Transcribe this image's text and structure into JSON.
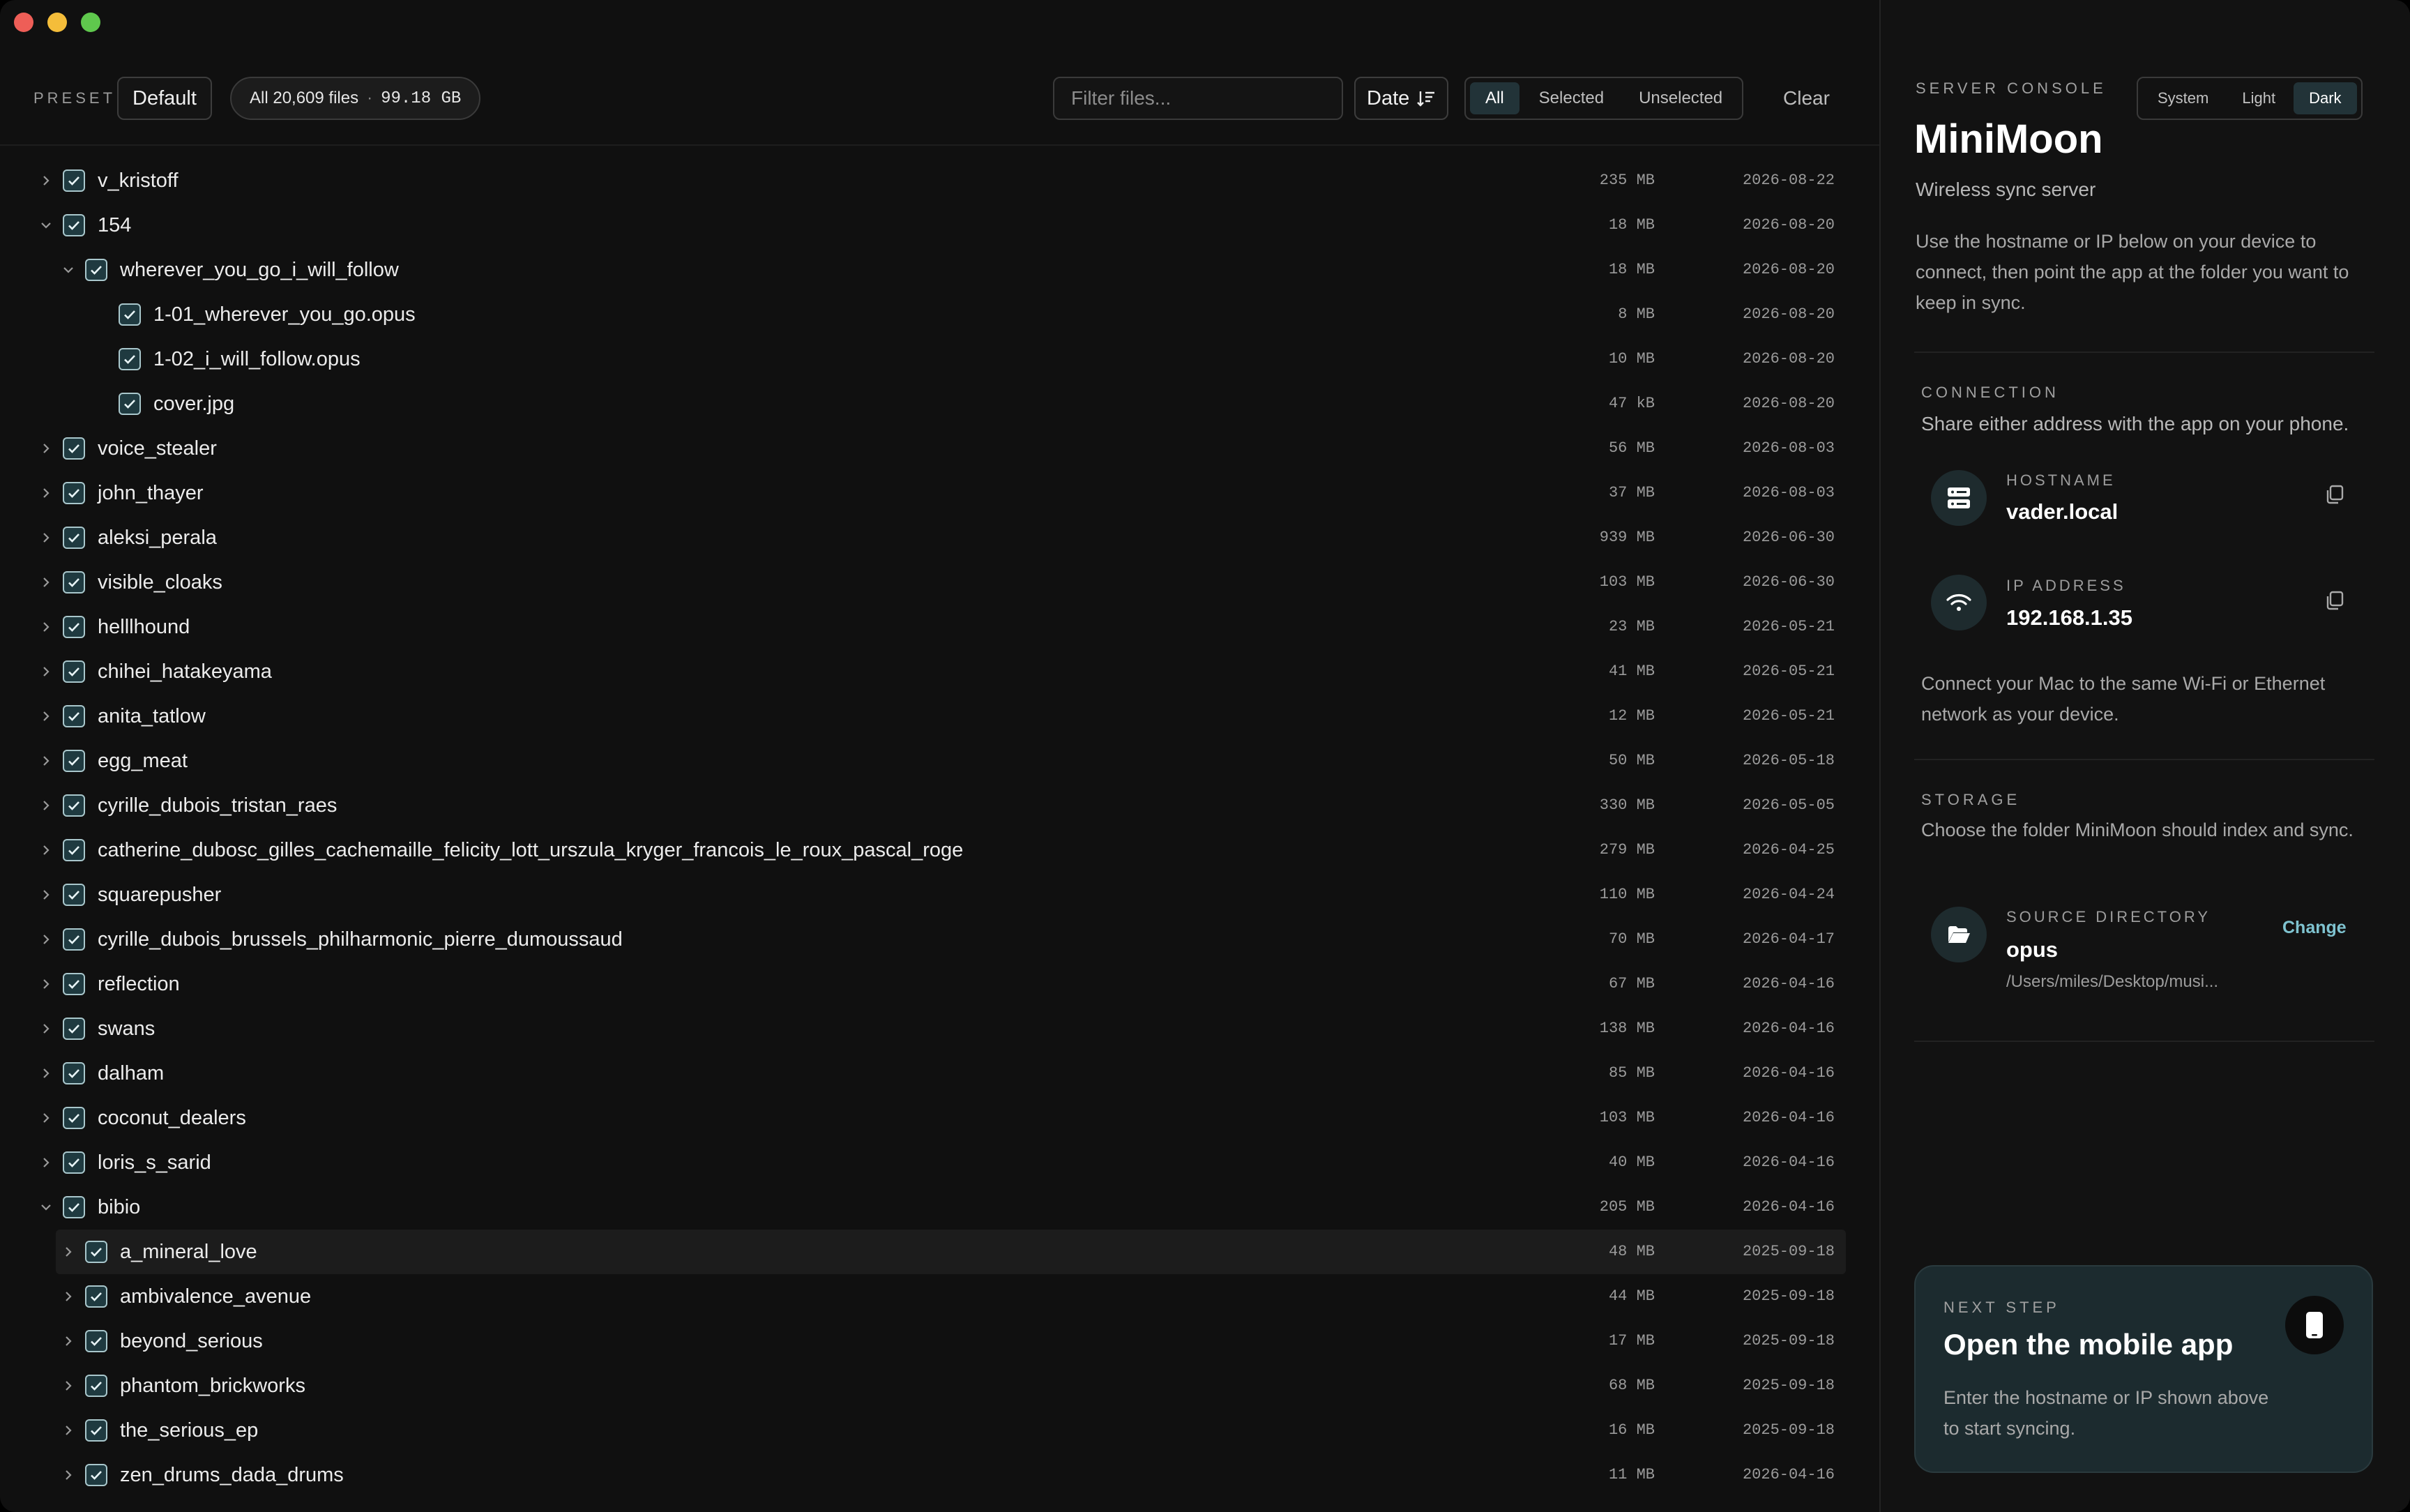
{
  "window": {
    "controls": [
      "close",
      "minimize",
      "zoom"
    ]
  },
  "toolbar": {
    "preset_label": "PRESET",
    "preset_value": "Default",
    "files_summary": "All 20,609 files",
    "files_separator": "·",
    "files_size": "99.18 GB",
    "filter_placeholder": "Filter files...",
    "sort_label": "Date",
    "sort_icon": "sort-descending-icon",
    "segments": [
      "All",
      "Selected",
      "Unselected"
    ],
    "active_segment": "All",
    "clear_label": "Clear"
  },
  "rows": [
    {
      "name": "v_kristoff",
      "size": "235 MB",
      "date": "2026-08-22",
      "level": 0,
      "chevron": "right",
      "checked": true
    },
    {
      "name": "154",
      "size": "18 MB",
      "date": "2026-08-20",
      "level": 0,
      "chevron": "down",
      "checked": true
    },
    {
      "name": "wherever_you_go_i_will_follow",
      "size": "18 MB",
      "date": "2026-08-20",
      "level": 1,
      "chevron": "down",
      "checked": true
    },
    {
      "name": "1-01_wherever_you_go.opus",
      "size": "8 MB",
      "date": "2026-08-20",
      "level": 2,
      "chevron": "none",
      "checked": true
    },
    {
      "name": "1-02_i_will_follow.opus",
      "size": "10 MB",
      "date": "2026-08-20",
      "level": 2,
      "chevron": "none",
      "checked": true
    },
    {
      "name": "cover.jpg",
      "size": "47 kB",
      "date": "2026-08-20",
      "level": 2,
      "chevron": "none",
      "checked": true
    },
    {
      "name": "voice_stealer",
      "size": "56 MB",
      "date": "2026-08-03",
      "level": 0,
      "chevron": "right",
      "checked": true
    },
    {
      "name": "john_thayer",
      "size": "37 MB",
      "date": "2026-08-03",
      "level": 0,
      "chevron": "right",
      "checked": true
    },
    {
      "name": "aleksi_perala",
      "size": "939 MB",
      "date": "2026-06-30",
      "level": 0,
      "chevron": "right",
      "checked": true
    },
    {
      "name": "visible_cloaks",
      "size": "103 MB",
      "date": "2026-06-30",
      "level": 0,
      "chevron": "right",
      "checked": true
    },
    {
      "name": "helllhound",
      "size": "23 MB",
      "date": "2026-05-21",
      "level": 0,
      "chevron": "right",
      "checked": true
    },
    {
      "name": "chihei_hatakeyama",
      "size": "41 MB",
      "date": "2026-05-21",
      "level": 0,
      "chevron": "right",
      "checked": true
    },
    {
      "name": "anita_tatlow",
      "size": "12 MB",
      "date": "2026-05-21",
      "level": 0,
      "chevron": "right",
      "checked": true
    },
    {
      "name": "egg_meat",
      "size": "50 MB",
      "date": "2026-05-18",
      "level": 0,
      "chevron": "right",
      "checked": true
    },
    {
      "name": "cyrille_dubois_tristan_raes",
      "size": "330 MB",
      "date": "2026-05-05",
      "level": 0,
      "chevron": "right",
      "checked": true
    },
    {
      "name": "catherine_dubosc_gilles_cachemaille_felicity_lott_urszula_kryger_francois_le_roux_pascal_roge",
      "size": "279 MB",
      "date": "2026-04-25",
      "level": 0,
      "chevron": "right",
      "checked": true
    },
    {
      "name": "squarepusher",
      "size": "110 MB",
      "date": "2026-04-24",
      "level": 0,
      "chevron": "right",
      "checked": true
    },
    {
      "name": "cyrille_dubois_brussels_philharmonic_pierre_dumoussaud",
      "size": "70 MB",
      "date": "2026-04-17",
      "level": 0,
      "chevron": "right",
      "checked": true
    },
    {
      "name": "reflection",
      "size": "67 MB",
      "date": "2026-04-16",
      "level": 0,
      "chevron": "right",
      "checked": true
    },
    {
      "name": "swans",
      "size": "138 MB",
      "date": "2026-04-16",
      "level": 0,
      "chevron": "right",
      "checked": true
    },
    {
      "name": "dalham",
      "size": "85 MB",
      "date": "2026-04-16",
      "level": 0,
      "chevron": "right",
      "checked": true
    },
    {
      "name": "coconut_dealers",
      "size": "103 MB",
      "date": "2026-04-16",
      "level": 0,
      "chevron": "right",
      "checked": true
    },
    {
      "name": "loris_s_sarid",
      "size": "40 MB",
      "date": "2026-04-16",
      "level": 0,
      "chevron": "right",
      "checked": true
    },
    {
      "name": "bibio",
      "size": "205 MB",
      "date": "2026-04-16",
      "level": 0,
      "chevron": "down",
      "checked": true
    },
    {
      "name": "a_mineral_love",
      "size": "48 MB",
      "date": "2025-09-18",
      "level": 1,
      "chevron": "right",
      "checked": true,
      "highlight": true
    },
    {
      "name": "ambivalence_avenue",
      "size": "44 MB",
      "date": "2025-09-18",
      "level": 1,
      "chevron": "right",
      "checked": true
    },
    {
      "name": "beyond_serious",
      "size": "17 MB",
      "date": "2025-09-18",
      "level": 1,
      "chevron": "right",
      "checked": true
    },
    {
      "name": "phantom_brickworks",
      "size": "68 MB",
      "date": "2025-09-18",
      "level": 1,
      "chevron": "right",
      "checked": true
    },
    {
      "name": "the_serious_ep",
      "size": "16 MB",
      "date": "2025-09-18",
      "level": 1,
      "chevron": "right",
      "checked": true
    },
    {
      "name": "zen_drums_dada_drums",
      "size": "11 MB",
      "date": "2026-04-16",
      "level": 1,
      "chevron": "right",
      "checked": true
    }
  ],
  "console": {
    "eyebrow": "SERVER CONSOLE",
    "app_name": "MiniMoon",
    "subtitle": "Wireless sync server",
    "intro": "Use the hostname or IP below on your device to connect, then point the app at the folder you want to keep in sync.",
    "theme_options": [
      "System",
      "Light",
      "Dark"
    ],
    "theme_active": "Dark",
    "connection": {
      "heading": "CONNECTION",
      "description": "Share either address with the app on your phone.",
      "hostname_label": "HOSTNAME",
      "hostname_value": "vader.local",
      "hostname_icon": "server-icon",
      "ip_label": "IP ADDRESS",
      "ip_value": "192.168.1.35",
      "ip_icon": "wifi-icon",
      "note": "Connect your Mac to the same Wi-Fi or Ethernet network as your device."
    },
    "storage": {
      "heading": "STORAGE",
      "description": "Choose the folder MiniMoon should index and sync.",
      "source_label": "SOURCE DIRECTORY",
      "source_name": "opus",
      "source_path": "/Users/miles/Desktop/musi...",
      "change_label": "Change",
      "folder_icon": "folder-open-icon"
    },
    "next_step": {
      "eyebrow": "NEXT STEP",
      "title": "Open the mobile app",
      "body": "Enter the hostname or IP shown above to start syncing.",
      "icon": "phone-icon"
    }
  },
  "colors": {
    "accent": "#7fc3d0",
    "checkbox_fill": "#1f3a40",
    "active_segment_bg": "#223338"
  }
}
